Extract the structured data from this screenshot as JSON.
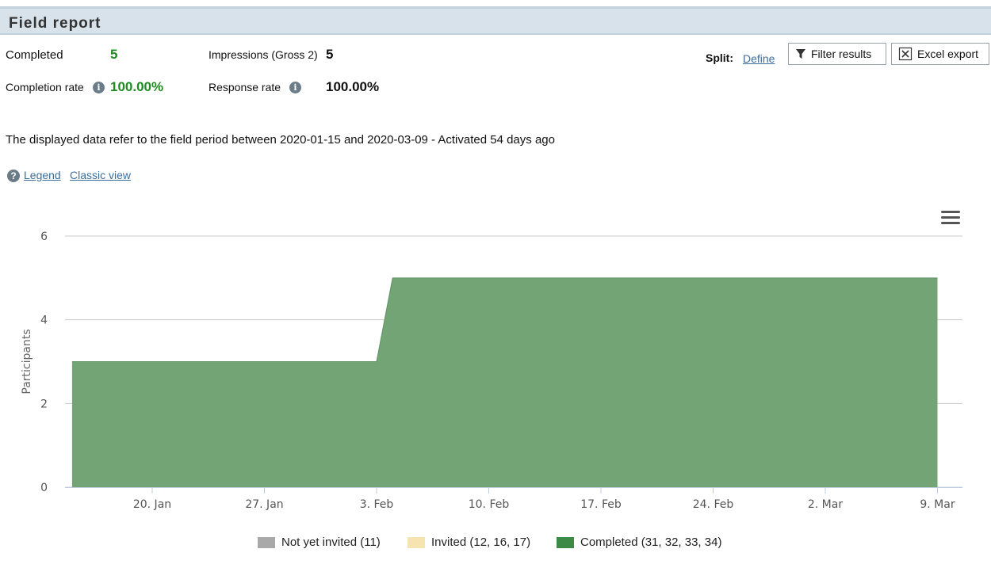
{
  "header": {
    "title": "Field report"
  },
  "stats": {
    "completed_label": "Completed",
    "completed_value": "5",
    "impressions_label": "Impressions (Gross 2)",
    "impressions_value": "5",
    "completion_rate_label": "Completion rate",
    "completion_rate_value": "100.00%",
    "response_rate_label": "Response rate",
    "response_rate_value": "100.00%"
  },
  "toolbar": {
    "split_label": "Split:",
    "split_link": "Define",
    "filter_label": "Filter results",
    "export_label": "Excel export"
  },
  "period_text": "The displayed data refer to the field period between 2020-01-15 and 2020-03-09 - Activated 54 days ago",
  "links": {
    "legend": "Legend",
    "classic_view": "Classic view"
  },
  "icons": {
    "info": "info-icon",
    "help": "question-icon",
    "filter": "funnel-icon",
    "export": "excel-icon",
    "menu": "hamburger-menu-icon"
  },
  "colors": {
    "completed": "#72a476",
    "invited": "#f5e4b0",
    "not_invited": "#a9a9a9",
    "accent_green": "#1f8a1f",
    "link": "#3b6e9c"
  },
  "chart_data": {
    "type": "area",
    "ylabel": "Participants",
    "ylim": [
      0,
      6
    ],
    "yticks": [
      0,
      2,
      4,
      6
    ],
    "xticks": [
      "20. Jan",
      "27. Jan",
      "3. Feb",
      "10. Feb",
      "17. Feb",
      "24. Feb",
      "2. Mar",
      "9. Mar"
    ],
    "grid": true,
    "legend_position": "bottom",
    "series": [
      {
        "name": "Completed (31, 32, 33, 34)",
        "color": "#72a476",
        "points": [
          {
            "date": "2020-01-15",
            "value": 3
          },
          {
            "date": "2020-02-03",
            "value": 3
          },
          {
            "date": "2020-02-04",
            "value": 5
          },
          {
            "date": "2020-03-09",
            "value": 5
          }
        ]
      }
    ],
    "legend": [
      {
        "label": "Not yet invited (11)",
        "color": "#a9a9a9"
      },
      {
        "label": "Invited (12, 16, 17)",
        "color": "#f5e4b0"
      },
      {
        "label": "Completed (31, 32, 33, 34)",
        "color": "#3c8a45"
      }
    ]
  }
}
